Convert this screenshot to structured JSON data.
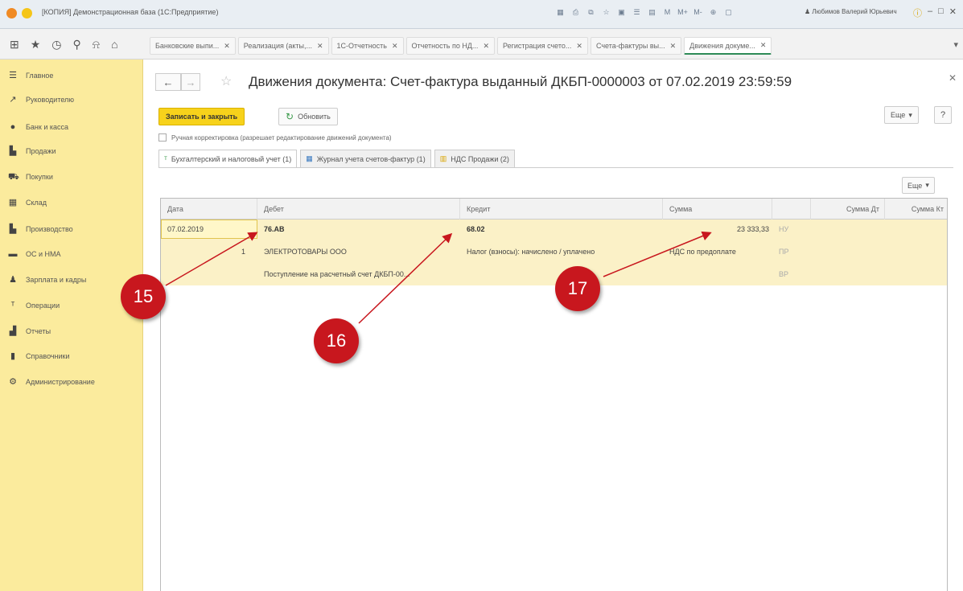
{
  "window": {
    "title": "[КОПИЯ] Демонстрационная база  (1С:Предприятие)",
    "user": "Любимов Валерий Юрьевич",
    "tools": [
      "M",
      "M+",
      "M-"
    ]
  },
  "tabs": [
    {
      "label": "Банковские выпи..."
    },
    {
      "label": "Реализация (акты,..."
    },
    {
      "label": "1С-Отчетность"
    },
    {
      "label": "Отчетность по НД..."
    },
    {
      "label": "Регистрация счето..."
    },
    {
      "label": "Счета-фактуры вы..."
    },
    {
      "label": "Движения докуме..."
    }
  ],
  "sidebar": {
    "items": [
      {
        "label": "Главное",
        "icon": "menu-icon"
      },
      {
        "label": "Руководителю",
        "icon": "chart-line-icon"
      },
      {
        "label": "Банк и касса",
        "icon": "bank-icon"
      },
      {
        "label": "Продажи",
        "icon": "sales-icon"
      },
      {
        "label": "Покупки",
        "icon": "cart-icon"
      },
      {
        "label": "Склад",
        "icon": "warehouse-icon"
      },
      {
        "label": "Производство",
        "icon": "production-icon"
      },
      {
        "label": "ОС и НМА",
        "icon": "truck-icon"
      },
      {
        "label": "Зарплата и кадры",
        "icon": "person-icon"
      },
      {
        "label": "Операции",
        "icon": "operations-icon"
      },
      {
        "label": "Отчеты",
        "icon": "reports-icon"
      },
      {
        "label": "Справочники",
        "icon": "books-icon"
      },
      {
        "label": "Администрирование",
        "icon": "gear-icon"
      }
    ]
  },
  "document": {
    "title": "Движения документа: Счет-фактура выданный ДКБП-0000003 от 07.02.2019 23:59:59"
  },
  "toolbar": {
    "save_close": "Записать и закрыть",
    "refresh": "Обновить",
    "more": "Еще",
    "help": "?"
  },
  "manual_edit": {
    "label": "Ручная корректировка (разрешает редактирование движений документа)",
    "checked": false
  },
  "doc_tabs": [
    {
      "label": "Бухгалтерский и налоговый учет (1)",
      "active": true
    },
    {
      "label": "Журнал учета счетов-фактур (1)",
      "active": false
    },
    {
      "label": "НДС Продажи (2)",
      "active": false
    }
  ],
  "grid": {
    "more": "Еще",
    "columns": [
      "Дата",
      "Дебет",
      "Кредит",
      "Сумма",
      "",
      "Сумма Дт",
      "Сумма Кт"
    ],
    "row": {
      "date": "07.02.2019",
      "debit": "76.АВ",
      "credit": "68.02",
      "sum": "23 333,33",
      "type_nu": "НУ",
      "num": "1",
      "debit_sub1": "ЭЛЕКТРОТОВАРЫ ООО",
      "credit_sub1": "Налог (взносы): начислено / уплачено",
      "sum_sub1": "НДС по предоплате",
      "type_pr": "ПР",
      "debit_sub2": "Поступление на расчетный счет ДКБП-00...",
      "type_vr": "ВР"
    }
  },
  "callouts": [
    "15",
    "16",
    "17"
  ],
  "colors": {
    "sidebar": "#fbeb9d",
    "primary_button": "#f7d21b",
    "selected_row": "#fbf1c7",
    "callout": "#c8171e"
  }
}
